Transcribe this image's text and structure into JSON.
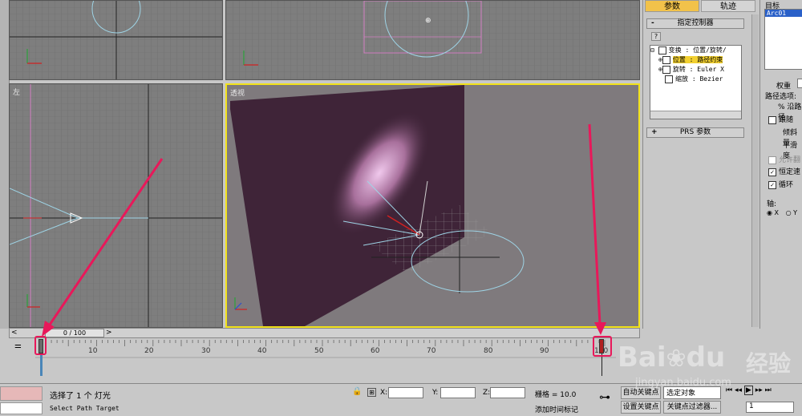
{
  "viewports": {
    "left_label": "左",
    "persp_label": "透视"
  },
  "cmd_panel": {
    "tab_params": "参数",
    "tab_trajectory": "轨迹",
    "rollout_assign": "指定控制器",
    "rollout_prs": "PRS 参数",
    "collapse_symbol": "-",
    "expand_symbol": "+",
    "help_btn": "?",
    "tree": [
      "变换 : 位置/旋转/",
      "位置 : 路径约束",
      "旋转 : Euler X",
      "缩放 : Bezier"
    ]
  },
  "right_panel": {
    "target_label": "目标",
    "target_item": "Arc01",
    "weight_label": "权重",
    "path_options_label": "路径选项:",
    "along_path": "% 沿路径",
    "follow": "跟随",
    "bank_amount": "倾斜量",
    "smoothness": "平滑度",
    "allow_flip": "允许翻",
    "const_velocity": "恒定速",
    "loop": "循环",
    "axis_label": "轴:",
    "axis_x": "X",
    "axis_y": "Y"
  },
  "timeline": {
    "frame_display": "0 / 100",
    "ticks": [
      "10",
      "20",
      "30",
      "40",
      "50",
      "60",
      "70",
      "80",
      "90",
      "100"
    ]
  },
  "status": {
    "selection_text": "选择了 1 个 灯光",
    "prompt_text": "Select Path Target",
    "x_label": "X:",
    "y_label": "Y:",
    "z_label": "Z:",
    "grid_text": "栅格 = 10.0",
    "add_time_tag": "添加时间标记",
    "auto_key": "自动关键点",
    "selected_obj": "选定对象",
    "set_key": "设置关键点",
    "key_filters": "关键点过滤器...",
    "frame_field": "1"
  },
  "watermark": {
    "brand": "Bai",
    "brand2": "du",
    "experience": "经验",
    "url": "jingyan.baidu.com"
  },
  "colors": {
    "highlight_red": "#e8185a",
    "active_border": "#f2e21a",
    "wall": "#3f2438",
    "viewport_bg": "#7e7e7e"
  }
}
